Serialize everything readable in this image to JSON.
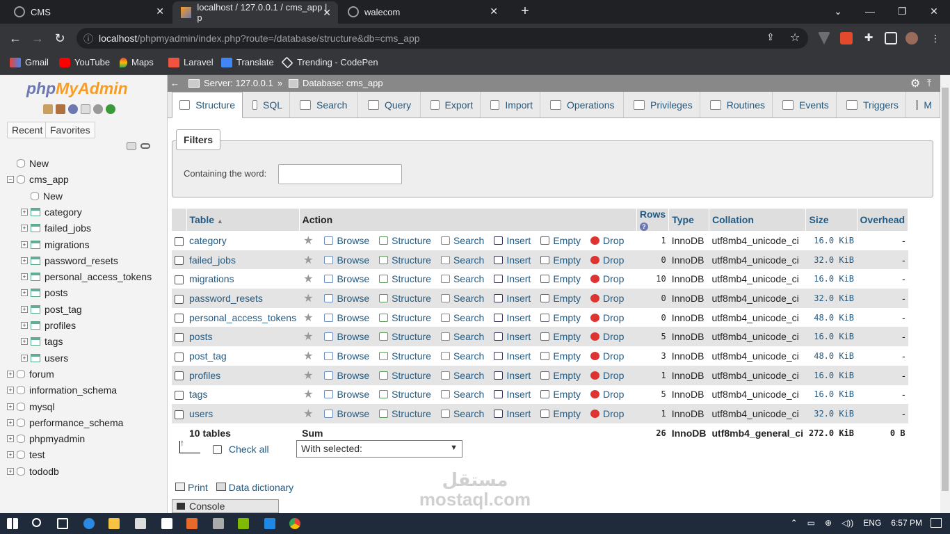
{
  "browser": {
    "tabs": [
      {
        "title": "CMS"
      },
      {
        "title": "localhost / 127.0.0.1 / cms_app | p"
      },
      {
        "title": "walecom"
      }
    ],
    "url_host": "localhost",
    "url_path": "/phpmyadmin/index.php?route=/database/structure&db=cms_app",
    "bookmarks": [
      "Gmail",
      "YouTube",
      "Maps",
      "Laravel",
      "Translate",
      "Trending - CodePen"
    ]
  },
  "sidebar": {
    "logo_a": "php",
    "logo_b": "MyAdmin",
    "recent": "Recent",
    "favorites": "Favorites",
    "tree": [
      {
        "label": "New",
        "level": 0
      },
      {
        "label": "cms_app",
        "level": 0
      },
      {
        "label": "New",
        "level": 1
      },
      {
        "label": "category",
        "level": 1
      },
      {
        "label": "failed_jobs",
        "level": 1
      },
      {
        "label": "migrations",
        "level": 1
      },
      {
        "label": "password_resets",
        "level": 1
      },
      {
        "label": "personal_access_tokens",
        "level": 1
      },
      {
        "label": "posts",
        "level": 1
      },
      {
        "label": "post_tag",
        "level": 1
      },
      {
        "label": "profiles",
        "level": 1
      },
      {
        "label": "tags",
        "level": 1
      },
      {
        "label": "users",
        "level": 1
      },
      {
        "label": "forum",
        "level": 0
      },
      {
        "label": "information_schema",
        "level": 0
      },
      {
        "label": "mysql",
        "level": 0
      },
      {
        "label": "performance_schema",
        "level": 0
      },
      {
        "label": "phpmyadmin",
        "level": 0
      },
      {
        "label": "test",
        "level": 0
      },
      {
        "label": "tododb",
        "level": 0
      }
    ]
  },
  "breadcrumb": {
    "server": "Server: 127.0.0.1",
    "sep": "»",
    "database": "Database: cms_app"
  },
  "menu_tabs": [
    "Structure",
    "SQL",
    "Search",
    "Query",
    "Export",
    "Import",
    "Operations",
    "Privileges",
    "Routines",
    "Events",
    "Triggers",
    "M"
  ],
  "filters": {
    "legend": "Filters",
    "label": "Containing the word:",
    "value": ""
  },
  "table": {
    "headers": {
      "table": "Table",
      "action": "Action",
      "rows": "Rows",
      "type": "Type",
      "collation": "Collation",
      "size": "Size",
      "overhead": "Overhead"
    },
    "actions": [
      "Browse",
      "Structure",
      "Search",
      "Insert",
      "Empty",
      "Drop"
    ],
    "rows": [
      {
        "name": "category",
        "rows": "1",
        "type": "InnoDB",
        "collation": "utf8mb4_unicode_ci",
        "size": "16.0 KiB",
        "overhead": "-"
      },
      {
        "name": "failed_jobs",
        "rows": "0",
        "type": "InnoDB",
        "collation": "utf8mb4_unicode_ci",
        "size": "32.0 KiB",
        "overhead": "-"
      },
      {
        "name": "migrations",
        "rows": "10",
        "type": "InnoDB",
        "collation": "utf8mb4_unicode_ci",
        "size": "16.0 KiB",
        "overhead": "-"
      },
      {
        "name": "password_resets",
        "rows": "0",
        "type": "InnoDB",
        "collation": "utf8mb4_unicode_ci",
        "size": "32.0 KiB",
        "overhead": "-"
      },
      {
        "name": "personal_access_tokens",
        "rows": "0",
        "type": "InnoDB",
        "collation": "utf8mb4_unicode_ci",
        "size": "48.0 KiB",
        "overhead": "-"
      },
      {
        "name": "posts",
        "rows": "5",
        "type": "InnoDB",
        "collation": "utf8mb4_unicode_ci",
        "size": "16.0 KiB",
        "overhead": "-"
      },
      {
        "name": "post_tag",
        "rows": "3",
        "type": "InnoDB",
        "collation": "utf8mb4_unicode_ci",
        "size": "48.0 KiB",
        "overhead": "-"
      },
      {
        "name": "profiles",
        "rows": "1",
        "type": "InnoDB",
        "collation": "utf8mb4_unicode_ci",
        "size": "16.0 KiB",
        "overhead": "-"
      },
      {
        "name": "tags",
        "rows": "5",
        "type": "InnoDB",
        "collation": "utf8mb4_unicode_ci",
        "size": "16.0 KiB",
        "overhead": "-"
      },
      {
        "name": "users",
        "rows": "1",
        "type": "InnoDB",
        "collation": "utf8mb4_unicode_ci",
        "size": "32.0 KiB",
        "overhead": "-"
      }
    ],
    "summary": {
      "name": "10 tables",
      "action": "Sum",
      "rows": "26",
      "type": "InnoDB",
      "collation": "utf8mb4_general_ci",
      "size": "272.0 KiB",
      "overhead": "0 B"
    }
  },
  "bulk": {
    "check_all": "Check all",
    "with_selected": "With selected:"
  },
  "footer_links": {
    "print": "Print",
    "data_dictionary": "Data dictionary",
    "console": "Console"
  },
  "watermark": "مستقل mostaql.com",
  "taskbar": {
    "lang": "ENG",
    "time": "6:57 PM"
  },
  "colors": {
    "link": "#235a81",
    "header_bg": "#dedede",
    "even_row": "#e4e4e4",
    "logo_php": "#6c78af",
    "logo_admin": "#f89d23"
  }
}
